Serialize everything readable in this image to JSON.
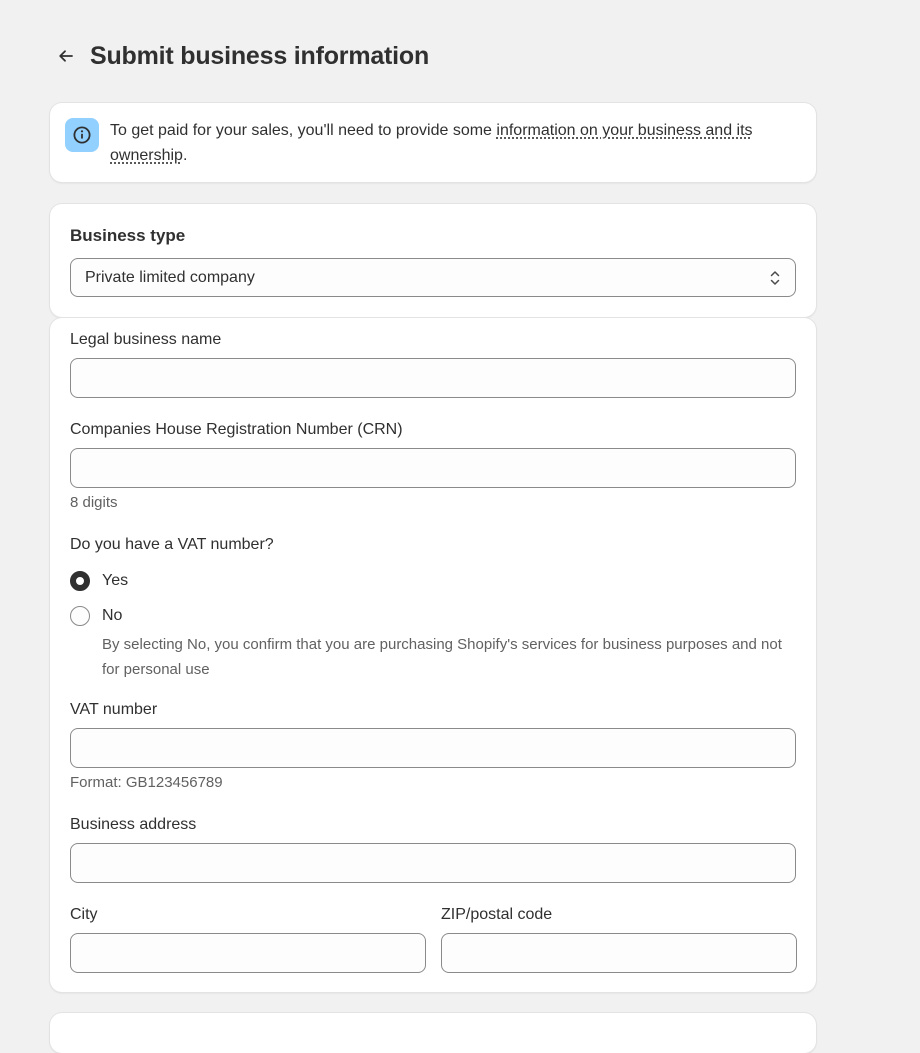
{
  "header": {
    "title": "Submit business information"
  },
  "banner": {
    "text_before": "To get paid for your sales, you'll need to provide some ",
    "link": "information on your business and its ownership",
    "text_after": "."
  },
  "business_type": {
    "title": "Business type",
    "selected": "Private limited company"
  },
  "form": {
    "legal_name_label": "Legal business name",
    "crn_label": "Companies House Registration Number (CRN)",
    "crn_help": "8 digits",
    "vat_question": "Do you have a VAT number?",
    "vat_yes": "Yes",
    "vat_no": "No",
    "vat_no_help": "By selecting No, you confirm that you are purchasing Shopify's services for business purposes and not for personal use",
    "vat_number_label": "VAT number",
    "vat_number_help": "Format: GB123456789",
    "address_label": "Business address",
    "city_label": "City",
    "zip_label": "ZIP/postal code"
  }
}
